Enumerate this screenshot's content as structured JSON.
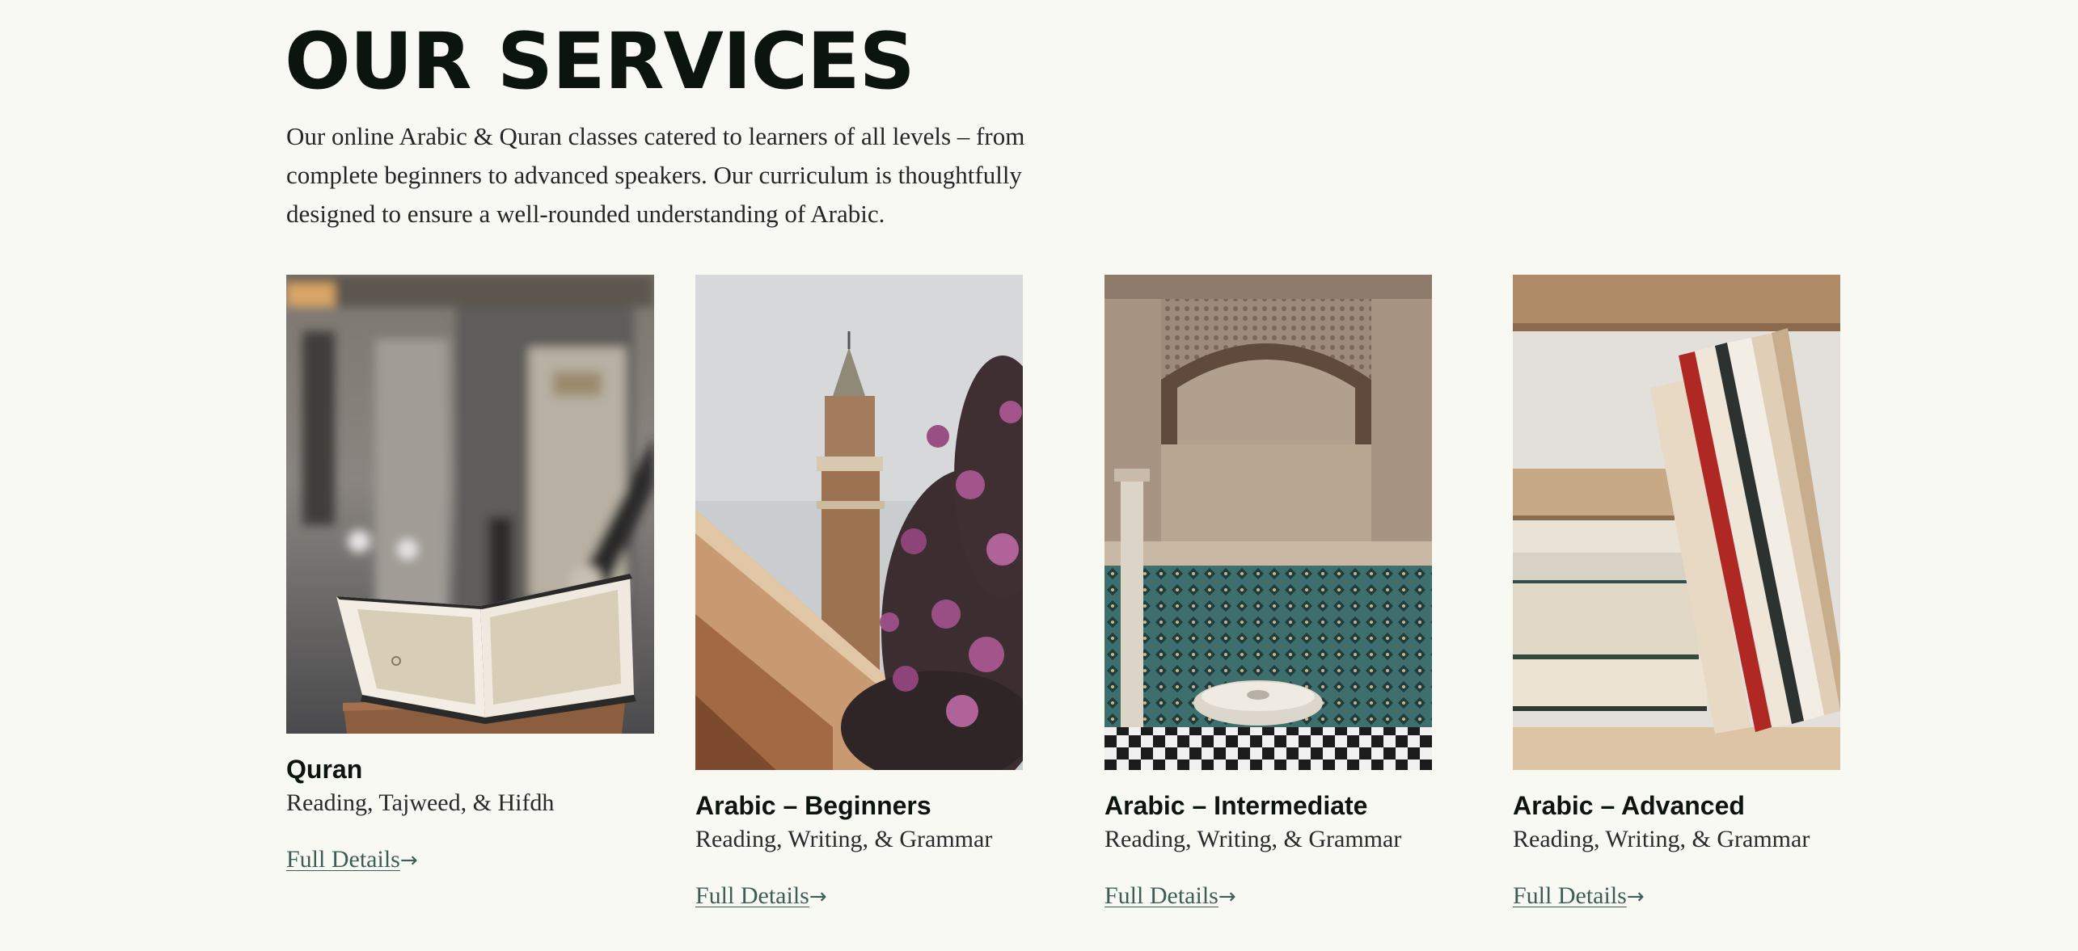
{
  "page": {
    "heading": "OUR SERVICES",
    "intro": "Our online Arabic & Quran classes catered to learners of all levels – from complete beginners to advanced speakers. Our curriculum is thoughtfully designed to ensure a well-rounded understanding of Arabic."
  },
  "services": [
    {
      "title": "Quran",
      "subtitle": "Reading, Tajweed, & Hifdh",
      "link_label": "Full Details",
      "link_arrow": "→"
    },
    {
      "title": "Arabic – Beginners",
      "subtitle": "Reading, Writing, & Grammar",
      "link_label": "Full Details",
      "link_arrow": "→"
    },
    {
      "title": "Arabic – Intermediate",
      "subtitle": "Reading, Writing, & Grammar",
      "link_label": "Full Details",
      "link_arrow": "→"
    },
    {
      "title": "Arabic – Advanced",
      "subtitle": "Reading, Writing, & Grammar",
      "link_label": "Full Details",
      "link_arrow": "→"
    }
  ],
  "colors": {
    "background": "#f9f9f4",
    "heading": "#0c140e",
    "link": "#3d5e57"
  }
}
